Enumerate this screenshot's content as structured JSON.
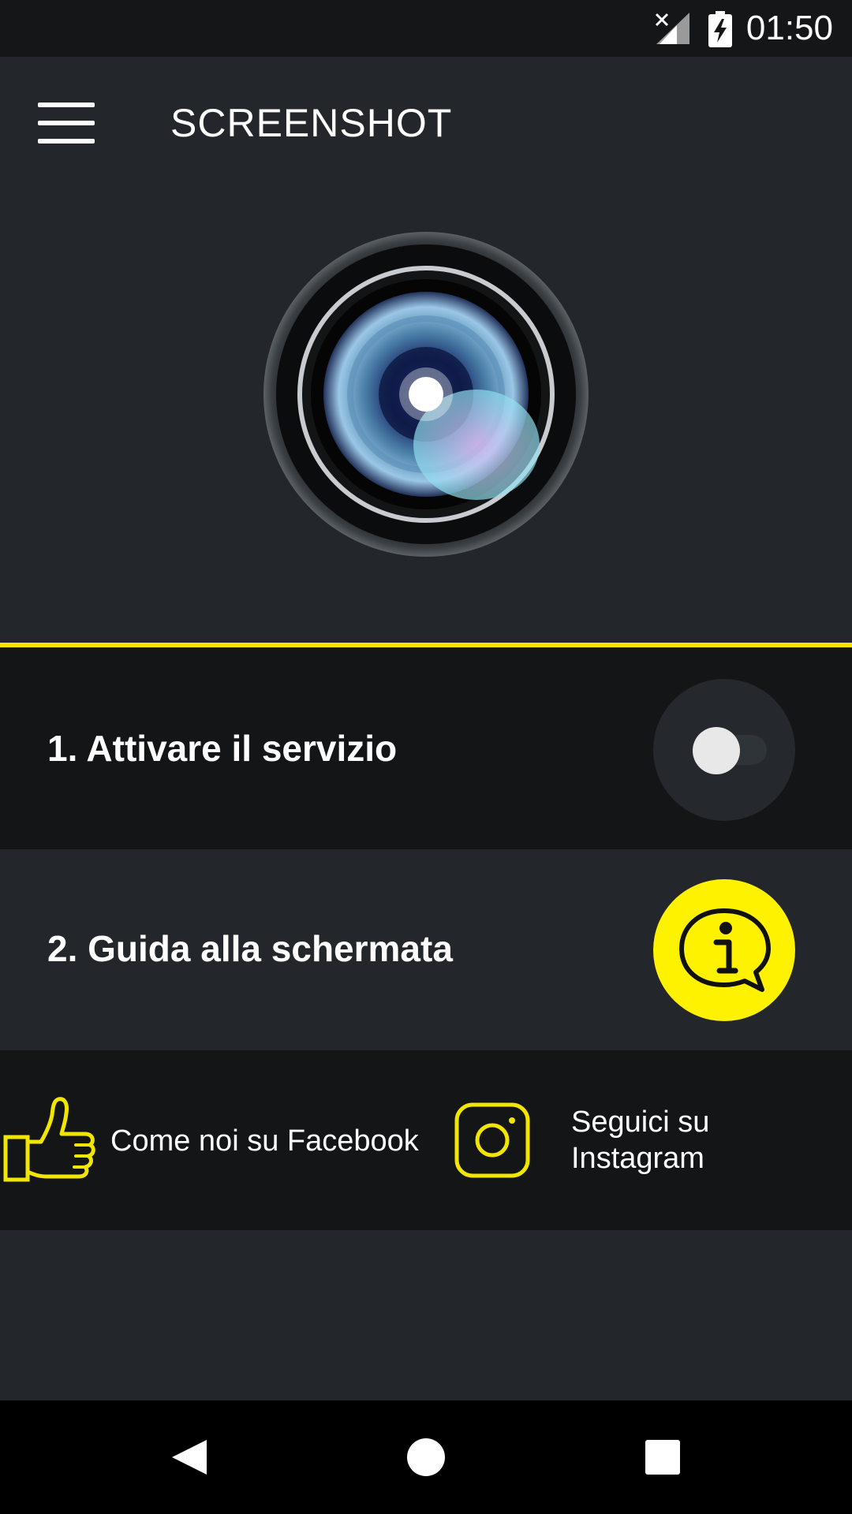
{
  "status_bar": {
    "time": "01:50",
    "icons": [
      "signal-off-icon",
      "battery-charging-icon"
    ]
  },
  "app_bar": {
    "title": "SCREENSHOT",
    "menu_icon": "hamburger-menu-icon"
  },
  "hero": {
    "image": "camera-lens-image"
  },
  "colors": {
    "accent": "#f2e600",
    "background": "#23272c",
    "dark_panel": "#131517"
  },
  "steps": [
    {
      "label": "1. Attivare il servizio",
      "control": "toggle",
      "enabled": false
    },
    {
      "label": "2. Guida alla schermata",
      "control": "info-button",
      "icon": "info-chat-icon"
    }
  ],
  "social": {
    "facebook": {
      "label": "Come noi su Facebook",
      "icon": "thumbs-up-icon"
    },
    "instagram": {
      "label_line1": "Seguici su",
      "label_line2": "Instagram",
      "icon": "instagram-icon"
    }
  },
  "nav_bar": {
    "buttons": [
      "back-icon",
      "home-icon",
      "recents-icon"
    ]
  }
}
